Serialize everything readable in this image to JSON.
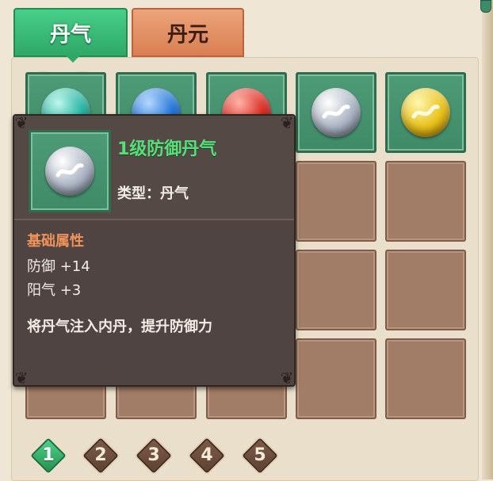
{
  "tabs": [
    {
      "label": "丹气",
      "active": true
    },
    {
      "label": "丹元",
      "active": false
    }
  ],
  "inventory": {
    "orb_colors": [
      "teal",
      "blue",
      "red",
      "gray",
      "gold"
    ]
  },
  "tooltip": {
    "name": "1级防御丹气",
    "type": "类型：丹气",
    "section_title": "基础属性",
    "stats": [
      "防御 +14",
      "阳气 +3"
    ],
    "description": "将丹气注入内丹，提升防御力"
  },
  "pagination": {
    "pages": [
      "1",
      "2",
      "3",
      "4",
      "5"
    ],
    "current": "1"
  },
  "colors": {
    "accent_green": "#3fb873",
    "tooltip_bg": "#4f4441",
    "item_name": "#55e07a",
    "section_title": "#f0935a"
  }
}
